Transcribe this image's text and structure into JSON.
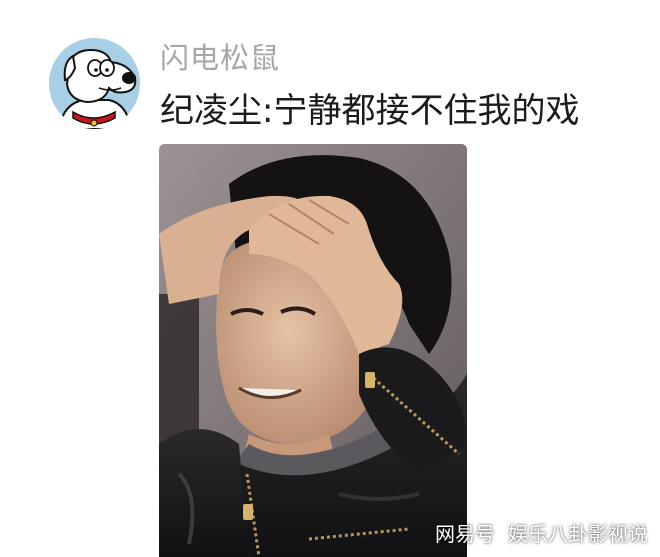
{
  "post": {
    "username": "闪电松鼠",
    "text": "纪凌尘:宁静都接不住我的戏",
    "avatar_icon": "cartoon-dog-avatar",
    "photo_description_icon": "photo"
  },
  "watermark": {
    "brand": "网易号",
    "channel": "娱乐八卦影视说"
  },
  "colors": {
    "username": "#a7a7a7",
    "text": "#1b1b1b",
    "avatar_bg": "#a9cfe6"
  }
}
